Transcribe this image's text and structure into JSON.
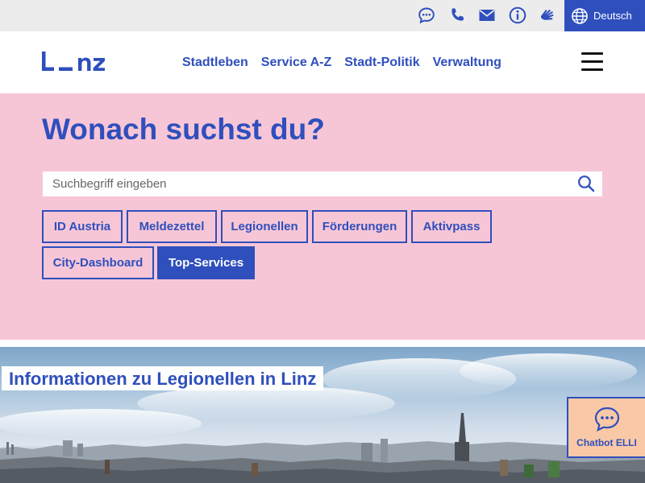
{
  "utility_bar": {
    "icons": [
      "chat-icon",
      "phone-icon",
      "mail-icon",
      "info-icon",
      "sign-language-icon"
    ],
    "language_label": "Deutsch",
    "accent_color": "#2f4fbd"
  },
  "header": {
    "logo_text": "L_nz",
    "nav": [
      {
        "label": "Stadtleben"
      },
      {
        "label": "Service A-Z"
      },
      {
        "label": "Stadt-Politik"
      },
      {
        "label": "Verwaltung"
      }
    ]
  },
  "search": {
    "heading": "Wonach suchst du?",
    "placeholder": "Suchbegriff eingeben",
    "background_color": "#f7c6d6",
    "chips": [
      {
        "label": "ID Austria",
        "active": false
      },
      {
        "label": "Meldezettel",
        "active": false
      },
      {
        "label": "Legionellen",
        "active": false
      },
      {
        "label": "Förderungen",
        "active": false
      },
      {
        "label": "Aktivpass",
        "active": false
      },
      {
        "label": "City-Dashboard",
        "active": false
      },
      {
        "label": "Top-Services",
        "active": true
      }
    ]
  },
  "hero": {
    "title": "Informationen zu Legionellen in Linz"
  },
  "chatbot": {
    "label": "Chatbot ELLI",
    "background_color": "#f9c8a6"
  }
}
